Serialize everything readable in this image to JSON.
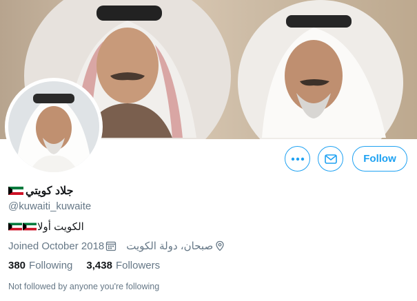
{
  "profile": {
    "display_name": "جلاد كويتي",
    "handle": "@kuwaiti_kuwaite",
    "bio": "الكويت أولا",
    "joined": "Joined October 2018",
    "location": "صبحان، دولة الكويت",
    "following_count": "380",
    "following_label": "Following",
    "followers_count": "3,438",
    "followers_label": "Followers",
    "followed_by_note": "Not followed by anyone you're following"
  },
  "actions": {
    "more_icon": "more-icon",
    "message_icon": "envelope-icon",
    "follow_label": "Follow"
  },
  "colors": {
    "accent": "#1da1f2",
    "secondary_text": "#657786",
    "primary_text": "#14171a"
  }
}
